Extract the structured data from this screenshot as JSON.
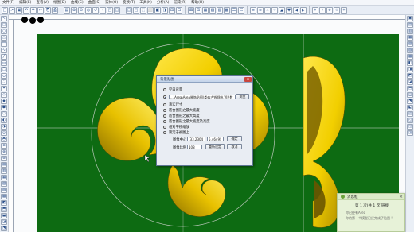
{
  "menubar": {
    "items": [
      "文件(F)",
      "编辑(E)",
      "查看(V)",
      "绘图(D)",
      "曲线(C)",
      "曲面(S)",
      "实体(O)",
      "变换(T)",
      "工具(K)",
      "分析(A)",
      "渲染(R)",
      "帮助(H)"
    ]
  },
  "toolbar": {
    "icons": [
      "□",
      "↗",
      "▣",
      "↶",
      "↷",
      "✂",
      "⎘",
      "⎙",
      "▤",
      "⊕",
      "⊖",
      "◎",
      "↺",
      "⌖",
      "◰",
      "◱",
      "◲",
      "◳",
      "⬚",
      "⬜",
      "◧",
      "◨",
      "⊞",
      "⊟",
      "⊠",
      "⊞",
      "▦",
      "▧",
      "▨",
      "▩",
      "☰",
      "☷",
      "≡",
      "≋",
      "∴",
      "∵",
      "▲",
      "▼",
      "◀",
      "▶",
      "✦",
      "✧",
      "★",
      "☆",
      "✶"
    ]
  },
  "left_toolbar": {
    "icons": [
      "↖",
      "□",
      "○",
      "△",
      "⌒",
      "∿",
      "╱",
      "▭",
      "◯",
      "⬭",
      "∴",
      "✦",
      "◇",
      "◆",
      "⬢",
      "⬡",
      "◐",
      "◑",
      "◒",
      "◓",
      "⊕",
      "⊗",
      "⊛",
      "▤",
      "▥",
      "▦",
      "▧",
      "▨",
      "▩",
      "◩",
      "⬒",
      "⬓",
      "◪",
      "⬔",
      "⬕"
    ]
  },
  "right_toolbar": {
    "icons": [
      "▣",
      "▤",
      "▥",
      "▦",
      "▧",
      "▨",
      "▩",
      "◧",
      "◨",
      "◩",
      "◪",
      "⬒",
      "⬓",
      "⬔",
      "⬕",
      "◰",
      "◱",
      "◲",
      "◳"
    ]
  },
  "dialog": {
    "title": "背景贴图",
    "close_label": "×",
    "options": [
      {
        "label": "空白背景",
        "selected": false
      },
      {
        "label": "",
        "selected": true
      },
      {
        "label": "真实尺寸",
        "selected": false
      },
      {
        "label": "适合图形之最大宽度",
        "selected": false
      },
      {
        "label": "适合图形之最大高度",
        "selected": false
      },
      {
        "label": "适合图形之最大宽度及高度",
        "selected": false
      },
      {
        "label": "相对平移缩放",
        "selected": false
      },
      {
        "label": "锁定于视图上",
        "selected": true
      }
    ],
    "file_path": "...\\Area\\Area装饰贴图\\类似古钱领结.VIP.数",
    "browse_label": "浏览",
    "center_label": "图像中心",
    "center_x": "(33.2304",
    "center_y": "5.4649)",
    "confirm_label": "确定",
    "scale_label": "图像比例",
    "scale_value": "108",
    "reset_label": "重新设定",
    "cancel_label": "取消"
  },
  "notification": {
    "title": "消息框",
    "close_label": "×",
    "body": "第 1 次(共 1 次)链接",
    "line1": "你已经有Area",
    "line2": "你的第一个模型已经完成了贴图 !"
  },
  "colors": {
    "canvas_green": "#0d6b12",
    "shape_yellow": "#f2cf00",
    "shape_shadow": "#7f6a00",
    "dialog_title_bg": "#c4d4ea",
    "notification_bg": "#e7f2d8"
  }
}
